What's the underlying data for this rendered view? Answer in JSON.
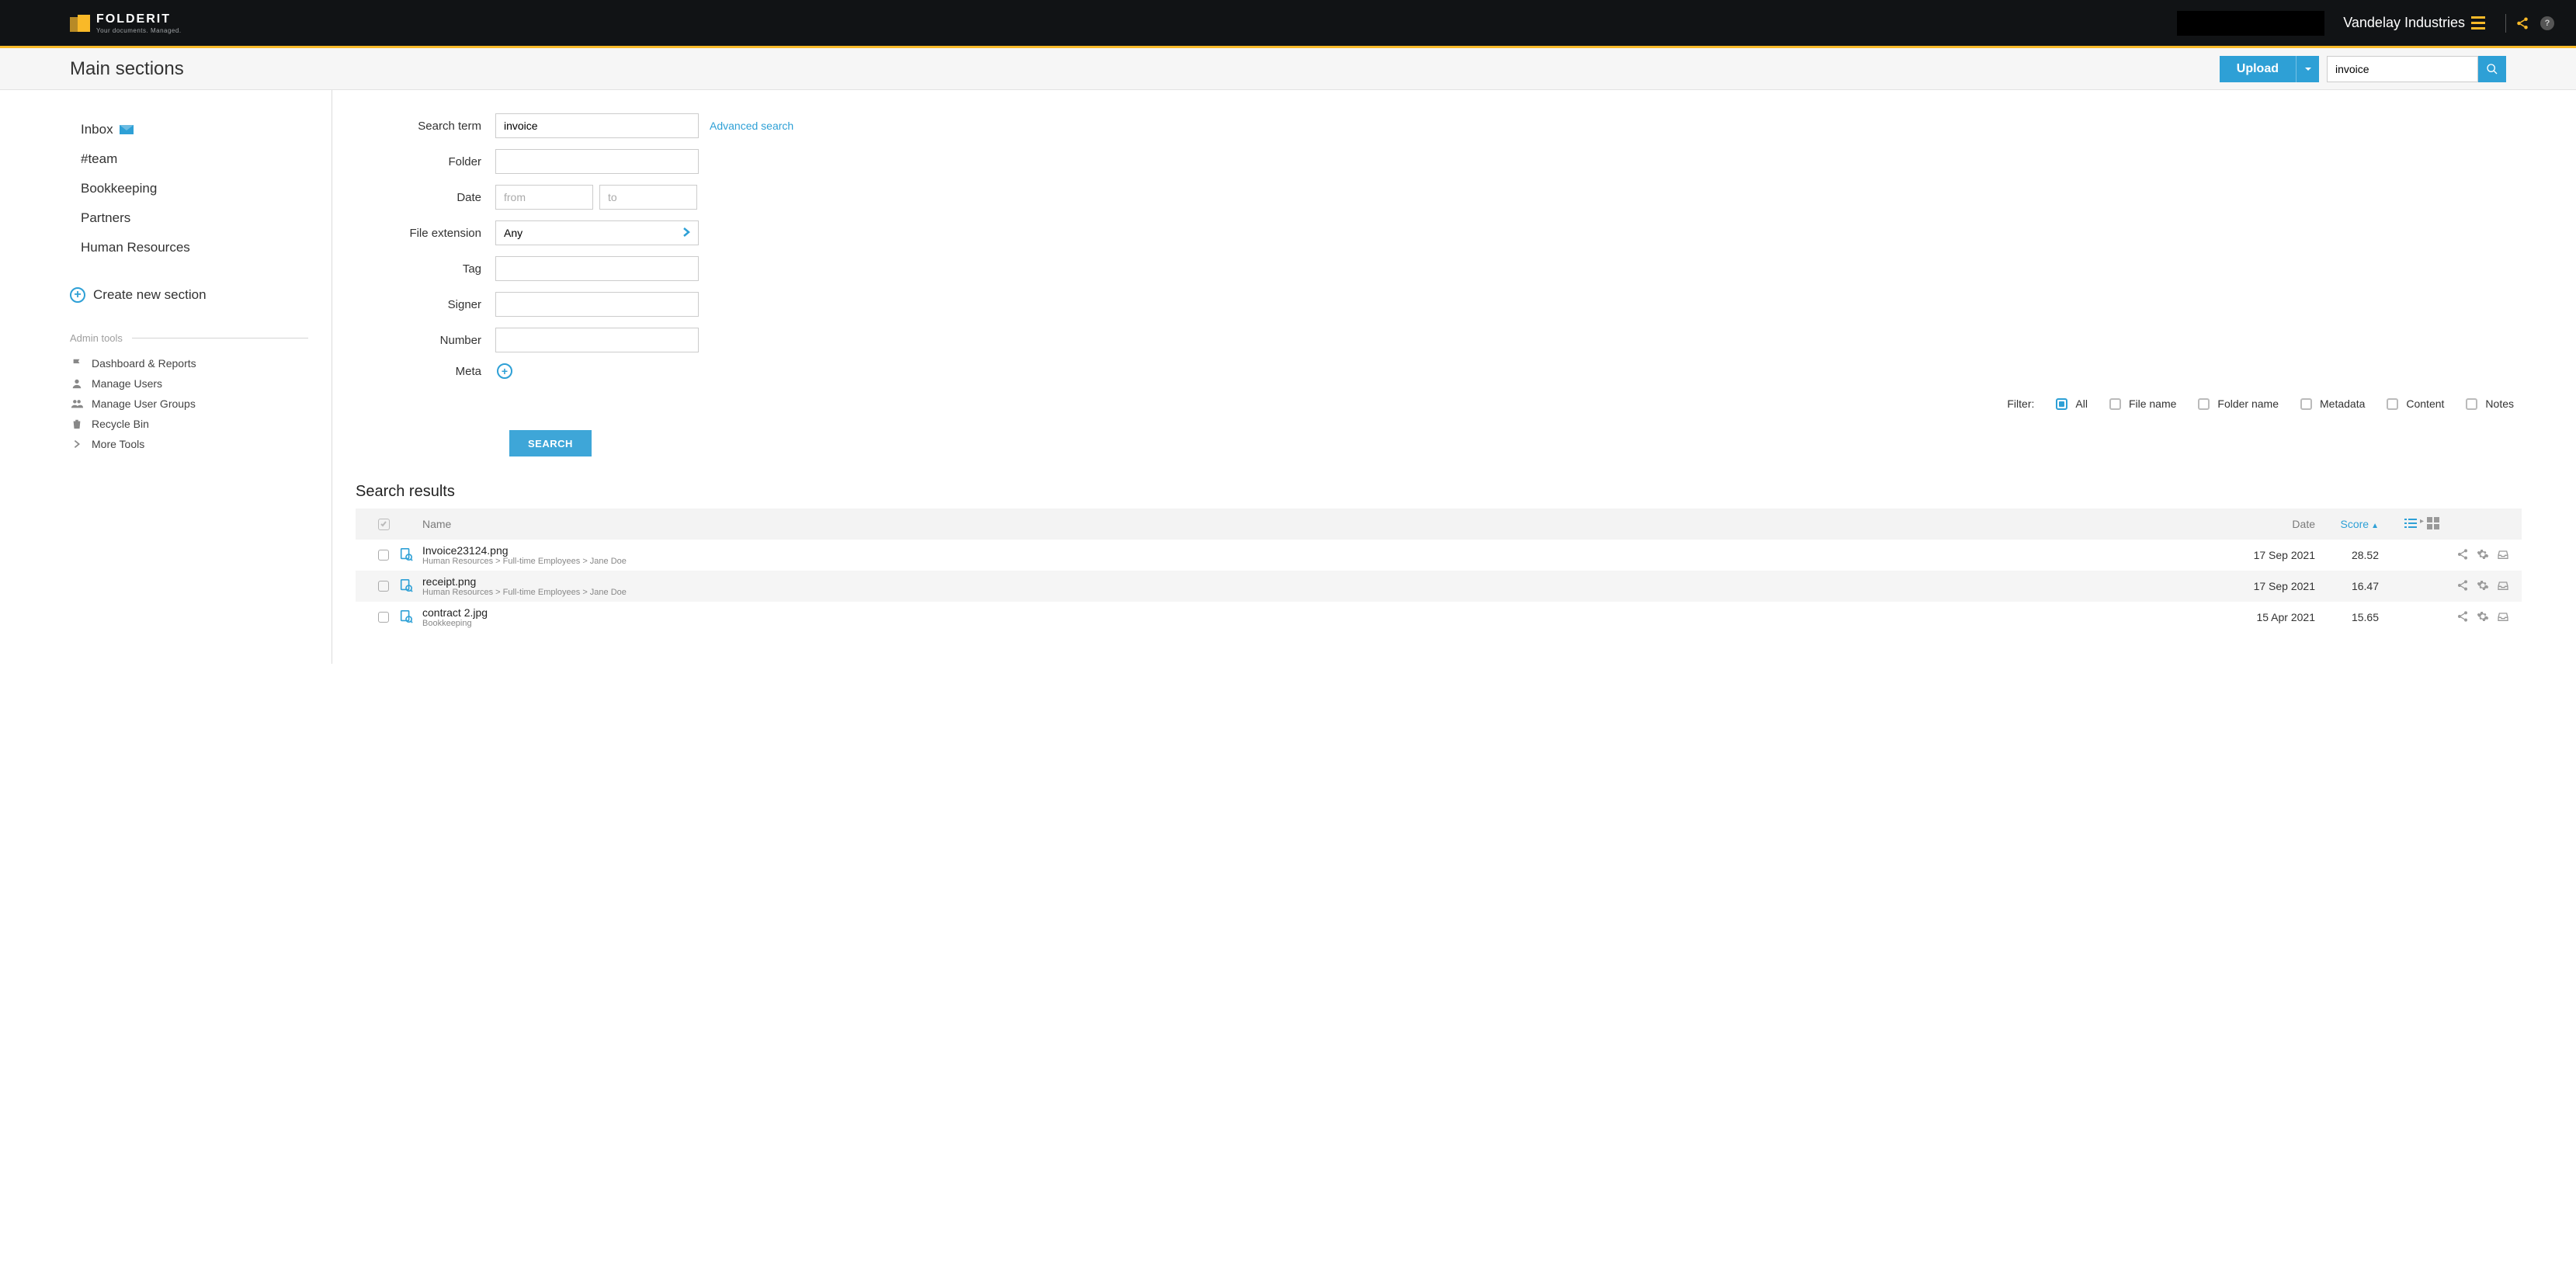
{
  "header": {
    "brand_name": "FOLDERIT",
    "brand_tagline": "Your documents. Managed.",
    "org_name": "Vandelay Industries"
  },
  "subheader": {
    "page_title": "Main sections",
    "upload_label": "Upload",
    "search_value": "invoice"
  },
  "sidebar": {
    "nav": [
      {
        "label": "Inbox",
        "has_mail_icon": true
      },
      {
        "label": "#team"
      },
      {
        "label": "Bookkeeping"
      },
      {
        "label": "Partners"
      },
      {
        "label": "Human Resources"
      }
    ],
    "create_label": "Create new section",
    "admin_label": "Admin tools",
    "admin_items": [
      {
        "label": "Dashboard & Reports",
        "icon": "flag"
      },
      {
        "label": "Manage Users",
        "icon": "user"
      },
      {
        "label": "Manage User Groups",
        "icon": "users"
      },
      {
        "label": "Recycle Bin",
        "icon": "trash"
      },
      {
        "label": "More Tools",
        "icon": "chevron"
      }
    ]
  },
  "form": {
    "labels": {
      "term": "Search term",
      "folder": "Folder",
      "date": "Date",
      "ext": "File extension",
      "tag": "Tag",
      "signer": "Signer",
      "number": "Number",
      "meta": "Meta"
    },
    "term_value": "invoice",
    "adv_link": "Advanced search",
    "date_from_ph": "from",
    "date_to_ph": "to",
    "ext_value": "Any",
    "filter_label": "Filter:",
    "filters": [
      {
        "label": "All",
        "active": true
      },
      {
        "label": "File name",
        "active": false
      },
      {
        "label": "Folder name",
        "active": false
      },
      {
        "label": "Metadata",
        "active": false
      },
      {
        "label": "Content",
        "active": false
      },
      {
        "label": "Notes",
        "active": false
      }
    ],
    "submit_label": "SEARCH"
  },
  "results": {
    "title": "Search results",
    "columns": {
      "name": "Name",
      "date": "Date",
      "score": "Score"
    },
    "rows": [
      {
        "name": "Invoice23124.png",
        "path": "Human Resources > Full-time Employees > Jane Doe",
        "date": "17 Sep 2021",
        "score": "28.52"
      },
      {
        "name": "receipt.png",
        "path": "Human Resources > Full-time Employees > Jane Doe",
        "date": "17 Sep 2021",
        "score": "16.47"
      },
      {
        "name": "contract 2.jpg",
        "path": "Bookkeeping",
        "date": "15 Apr 2021",
        "score": "15.65"
      }
    ]
  }
}
